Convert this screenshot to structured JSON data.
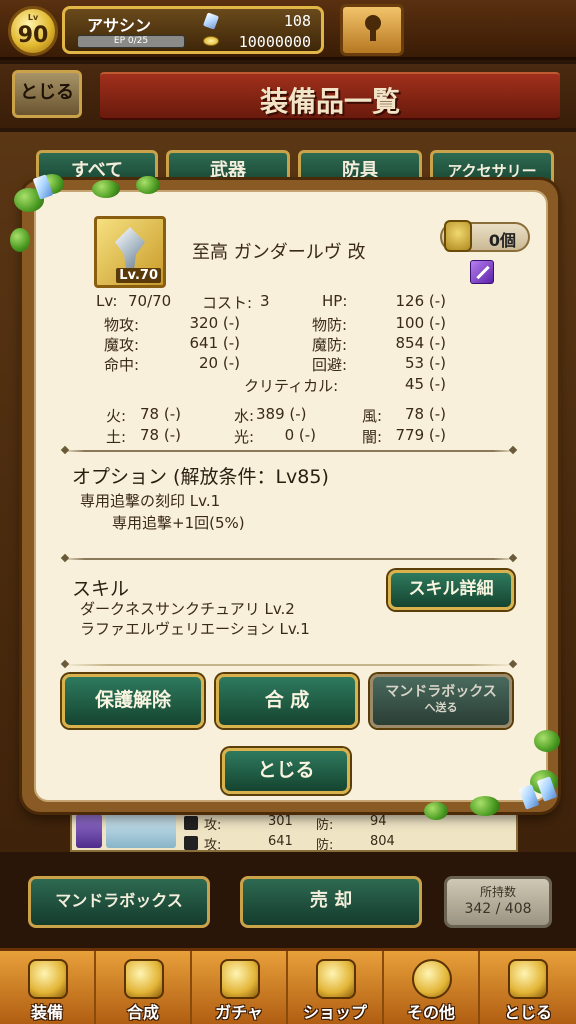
{
  "topbar": {
    "level_label": "Lv",
    "level": "90",
    "player_name": "アサシン",
    "ep_text": "EP 0/25",
    "gems": "108",
    "coins": "10000000"
  },
  "titlebar": {
    "close_label": "とじる",
    "title": "装備品一覧"
  },
  "tabs": [
    "すべて",
    "武器",
    "防具",
    "アクセサリー"
  ],
  "bg_row": {
    "stat1_label": "攻:",
    "stat1_value": "301",
    "stat2_label": "防:",
    "stat2_value": "94",
    "stat3_label": "攻:",
    "stat3_value": "641",
    "stat4_label": "防:",
    "stat4_value": "804"
  },
  "dialog": {
    "item": {
      "name": "至高 ガンダールヴ 改",
      "thumb_level": "Lv.70",
      "mandra_count": "0個"
    },
    "stats": {
      "lv_label": "Lv:",
      "lv_value": "70/70",
      "cost_label": "コスト:",
      "cost_value": "3",
      "hp_label": "HP:",
      "hp_value": "126 (-)",
      "patk_label": "物攻:",
      "patk_value": "320 (-)",
      "pdef_label": "物防:",
      "pdef_value": "100 (-)",
      "matk_label": "魔攻:",
      "matk_value": "641 (-)",
      "mdef_label": "魔防:",
      "mdef_value": "854 (-)",
      "hit_label": "命中:",
      "hit_value": "20 (-)",
      "eva_label": "回避:",
      "eva_value": "53 (-)",
      "crit_label": "クリティカル:",
      "crit_value": "45 (-)"
    },
    "elements": {
      "fire_label": "火:",
      "fire_value": "78 (-)",
      "water_label": "水:",
      "water_value": "389 (-)",
      "wind_label": "風:",
      "wind_value": "78 (-)",
      "earth_label": "土:",
      "earth_value": "78 (-)",
      "light_label": "光:",
      "light_value": "0 (-)",
      "dark_label": "闇:",
      "dark_value": "779 (-)"
    },
    "option": {
      "heading": "オプション (解放条件：Lv85)",
      "line1": "専用追撃の刻印 Lv.1",
      "line2": "専用追撃+1回(5%)"
    },
    "skill": {
      "heading": "スキル",
      "line1": "ダークネスサンクチュアリ  Lv.2",
      "line2": "ラファエルヴェリエーション  Lv.1",
      "detail_button": "スキル詳細"
    },
    "buttons": {
      "unprotect": "保護解除",
      "combine": "合 成",
      "send_top": "マンドラボックス",
      "send_bottom": "へ送る",
      "close": "とじる"
    }
  },
  "bottom": {
    "mandra_box": "マンドラボックス",
    "sell": "売 却",
    "owned_label": "所持数",
    "owned_value": "342 / 408"
  },
  "navbar": [
    "装備",
    "合成",
    "ガチャ",
    "ショップ",
    "その他",
    "とじる"
  ],
  "colors": {
    "green_button": "#2e7a5e",
    "gold_border": "#d9b24e",
    "dialog_bg": "#f8f0da"
  }
}
